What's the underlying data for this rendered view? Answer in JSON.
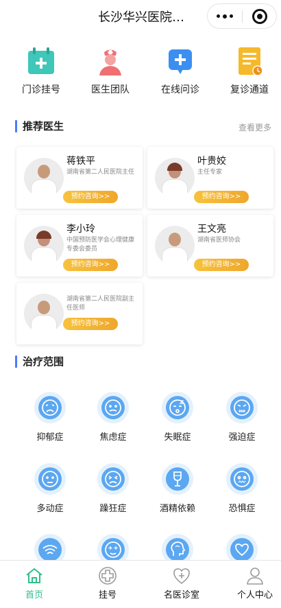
{
  "header": {
    "title": "长沙华兴医院…"
  },
  "quick_menu": [
    {
      "label": "门诊挂号",
      "icon": "calendar-plus-icon",
      "color": "#3fc7b9"
    },
    {
      "label": "医生团队",
      "icon": "nurse-icon",
      "color": "#f06f73"
    },
    {
      "label": "在线问诊",
      "icon": "chat-plus-icon",
      "color": "#3b8ff0"
    },
    {
      "label": "复诊通道",
      "icon": "document-clock-icon",
      "color": "#f5b92a"
    }
  ],
  "recommend": {
    "title": "推荐医生",
    "more": "查看更多"
  },
  "doctors": [
    {
      "name": "蒋铁平",
      "desc": "湖南省第二人民医院主任",
      "button": "预约咨询>>"
    },
    {
      "name": "叶贵姣",
      "desc": "主任专家",
      "button": "预约咨询>>"
    },
    {
      "name": "李小玲",
      "desc": "中国预防医学会心理健康专委会委员",
      "button": "预约咨询>>"
    },
    {
      "name": "王文亮",
      "desc": "湖南省医师协会",
      "button": "预约咨询>>"
    },
    {
      "name": "",
      "desc": "湖南省第二人民医院副主任医师",
      "button": "预约咨询>>"
    }
  ],
  "treatment": {
    "title": "治疗范围",
    "items": [
      {
        "label": "抑郁症",
        "icon": "sad-face-icon"
      },
      {
        "label": "焦虑症",
        "icon": "worried-face-icon"
      },
      {
        "label": "失眠症",
        "icon": "sleepy-face-icon"
      },
      {
        "label": "强迫症",
        "icon": "angry-face-icon"
      },
      {
        "label": "多动症",
        "icon": "blank-face-icon"
      },
      {
        "label": "躁狂症",
        "icon": "frustrated-face-icon"
      },
      {
        "label": "酒精依赖",
        "icon": "wine-glass-icon"
      },
      {
        "label": "恐惧症",
        "icon": "fearful-face-icon"
      },
      {
        "label": "",
        "icon": "wifi-icon"
      },
      {
        "label": "",
        "icon": "star-eyes-face-icon"
      },
      {
        "label": "",
        "icon": "brain-head-icon"
      },
      {
        "label": "",
        "icon": "heart-icon"
      }
    ]
  },
  "tabbar": [
    {
      "label": "首页",
      "icon": "home-icon",
      "active": true
    },
    {
      "label": "挂号",
      "icon": "medical-cross-icon"
    },
    {
      "label": "名医诊室",
      "icon": "heart-plus-icon"
    },
    {
      "label": "个人中心",
      "icon": "user-icon"
    }
  ],
  "colors": {
    "accent": "#4a7bf7",
    "button": "#f0a92c",
    "active_tab": "#2ebf8b",
    "icon_blue": "#5ba7f1"
  }
}
